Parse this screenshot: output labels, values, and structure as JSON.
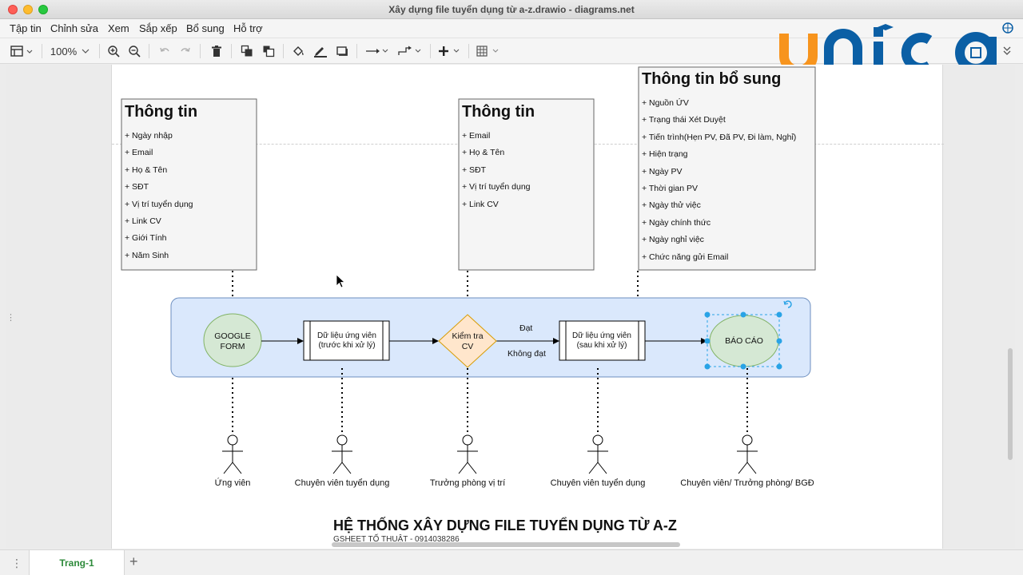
{
  "window": {
    "title": "Xây dựng file tuyển dụng từ a-z.drawio - diagrams.net"
  },
  "menu": {
    "items": [
      "Tập tin",
      "Chỉnh sửa",
      "Xem",
      "Sắp xếp",
      "Bổ sung",
      "Hỗ trợ"
    ]
  },
  "toolbar": {
    "zoom": "100%"
  },
  "logo": {
    "text": "unica"
  },
  "diagram": {
    "box1": {
      "title": "Thông tin",
      "items": [
        "+ Ngày nhập",
        "+ Email",
        "+ Họ & Tên",
        "+ SĐT",
        "+ Vị trí tuyển dụng",
        "+ Link CV",
        "+ Giới Tính",
        "+ Năm Sinh"
      ]
    },
    "box2": {
      "title": "Thông tin",
      "items": [
        "+ Email",
        "+ Họ & Tên",
        "+ SĐT",
        "+ Vị trí tuyển dụng",
        "+ Link CV"
      ]
    },
    "box3": {
      "title": "Thông tin bổ sung",
      "items": [
        "+ Nguồn ỨV",
        "+ Trạng thái Xét Duyệt",
        "+ Tiến trình(Hẹn PV, Đã PV, Đi làm, Nghỉ)",
        "+ Hiện trạng",
        "+ Ngày PV",
        "+ Thời gian PV",
        "+ Ngày thử việc",
        "+ Ngày chính thức",
        "+ Ngày nghỉ việc",
        "+ Chức năng gửi Email"
      ]
    },
    "flow": {
      "google_form": [
        "GOOGLE",
        "FORM"
      ],
      "data_before": [
        "Dữ liệu ứng viên",
        "(trước khi xử lý)"
      ],
      "check_cv": [
        "Kiểm tra",
        "CV"
      ],
      "pass_label": "Đạt",
      "fail_label": "Không đạt",
      "data_after": [
        "Dữ liệu ứng viên",
        "(sau khi xử lý)"
      ],
      "report": "BÁO CÁO"
    },
    "actors": [
      "Ứng viên",
      "Chuyên viên tuyển dụng",
      "Trưởng phòng vị trí",
      "Chuyên viên tuyển dụng",
      "Chuyên viên/ Trưởng phòng/ BGĐ"
    ],
    "heading": "HỆ THỐNG XÂY DỰNG FILE TUYỂN DỤNG TỪ A-Z",
    "subheading": "GSHEET TỐ THUẬT - 0914038286"
  },
  "tabs": {
    "page_tab": "Trang-1"
  },
  "colors": {
    "swimlane_fill": "#dae8fc",
    "swimlane_stroke": "#6c8ebf",
    "ellipse_fill": "#d5e8d4",
    "ellipse_stroke": "#82b366",
    "diamond_fill": "#ffe6cc",
    "diamond_stroke": "#d79b00",
    "note_fill": "#f5f5f5",
    "selection": "#29a3e6",
    "logo_orange": "#f7941d",
    "logo_blue": "#0b5fa5"
  }
}
